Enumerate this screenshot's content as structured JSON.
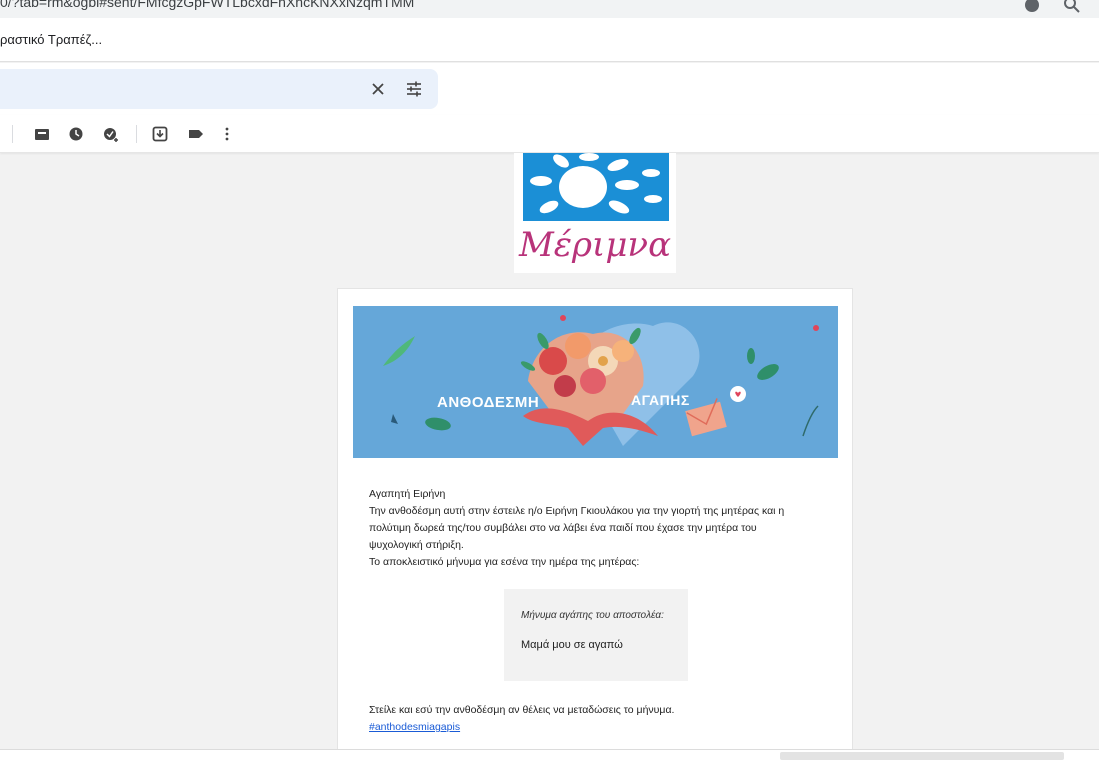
{
  "browser": {
    "url_fragment": "0/?tab=rm&ogbl#sent/FMfcgzGpFWTLbcxdFhXhcKNXxNzqmTMM",
    "bookmark_label": "ραστικό Τραπέζ..."
  },
  "toolbar_icons": [
    "archive-icon",
    "clock-icon",
    "add-task-icon",
    "move-to-icon",
    "label-icon",
    "more-icon"
  ],
  "logo": {
    "text": "Μέριμνα",
    "brand_blue": "#1b8fd6",
    "brand_magenta": "#b8337a"
  },
  "banner": {
    "left_text": "ΑΝΘΟΔΕΣΜΗ",
    "right_text": "ΑΓΑΠΗΣ",
    "color": "#65a7d9"
  },
  "email": {
    "greeting": "Αγαπητή Ειρήνη",
    "line1": "Την ανθοδέσμη αυτή στην έστειλε η/ο Ειρήνη Γκιουλάκου για την γιορτή της μητέρας και η",
    "line2": "πολύτιμη δωρεά της/του συμβάλει στο να λάβει ένα παιδί που έχασε την μητέρα του",
    "line3": "ψυχολογική στήριξη.",
    "line4": "Το αποκλειστικό μήνυμα για εσένα την ημέρα της μητέρας:",
    "quote_title": "Μήνυμα αγάπης του αποστολέα:",
    "quote_message": "Μαμά μου σε αγαπώ",
    "outro": "Στείλε και εσύ την ανθοδέσμη αν θέλεις να μεταδώσεις το μήνυμα.",
    "hashtag": "#anthodesmiagapis"
  }
}
